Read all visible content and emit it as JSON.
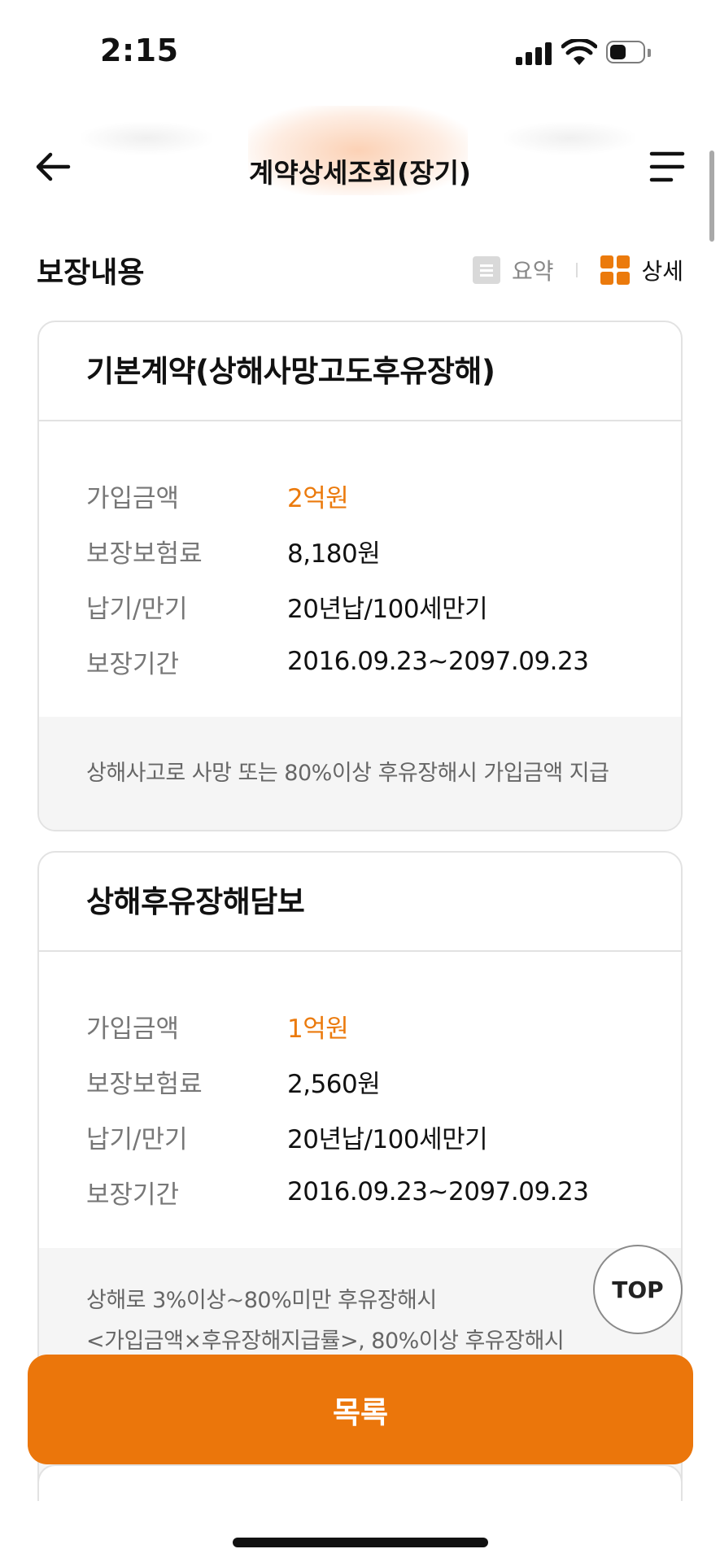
{
  "status_bar": {
    "time": "2:15"
  },
  "header": {
    "title": "계약상세조회(장기)"
  },
  "section": {
    "title": "보장내용",
    "view_toggle": {
      "summary_label": "요약",
      "detail_label": "상세",
      "selected": "상세"
    }
  },
  "coverages": [
    {
      "title": "기본계약(상해사망고도후유장해)",
      "rows": [
        {
          "label": "가입금액",
          "value": "2억원"
        },
        {
          "label": "보장보험료",
          "value": "8,180원"
        },
        {
          "label": "납기/만기",
          "value": "20년납/100세만기"
        },
        {
          "label": "보장기간",
          "value": "2016.09.23~2097.09.23"
        }
      ],
      "description": [
        "상해사고로 사망 또는 80%이상 후유장해시 가입금액 지급"
      ]
    },
    {
      "title": "상해후유장해담보",
      "rows": [
        {
          "label": "가입금액",
          "value": "1억원"
        },
        {
          "label": "보장보험료",
          "value": "2,560원"
        },
        {
          "label": "납기/만기",
          "value": "20년납/100세만기"
        },
        {
          "label": "보장기간",
          "value": "2016.09.23~2097.09.23"
        }
      ],
      "description": [
        "상해로 3%이상~80%미만 후유장해시",
        "<가입금액×후유장해지급률>, 80%이상 후유장해시"
      ]
    }
  ],
  "buttons": {
    "top": "TOP",
    "list": "목록"
  },
  "colors": {
    "accent": "#eb760b",
    "border": "#e2e2e2",
    "desc_bg": "#f5f5f5"
  }
}
